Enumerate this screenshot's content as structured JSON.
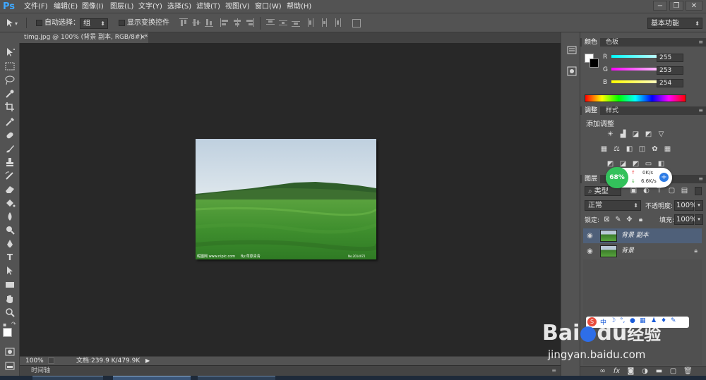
{
  "app": {
    "logo": "Ps"
  },
  "menu": [
    "文件(F)",
    "编辑(E)",
    "图像(I)",
    "图层(L)",
    "文字(Y)",
    "选择(S)",
    "滤镜(T)",
    "视图(V)",
    "窗口(W)",
    "帮助(H)"
  ],
  "window_controls": {
    "minimize": "−",
    "restore": "❐",
    "close": "✕"
  },
  "options": {
    "auto_select_label": "自动选择：",
    "auto_select_value": "组",
    "show_transform_label": "显示变换控件",
    "workspace": "基本功能"
  },
  "document": {
    "tab_title": "timg.jpg @ 100% (背景 副本, RGB/8#) *",
    "tab_close": "×",
    "watermark_left": "昵图网 www.nipic.com",
    "watermark_mid": "By:草原青青",
    "watermark_right": "No.2014072"
  },
  "status": {
    "zoom": "100%",
    "doc_size": "文档:239.9 K/479.9K",
    "timeline": "时间轴"
  },
  "color_panel": {
    "tabs": [
      "颜色",
      "色板"
    ],
    "channels": [
      {
        "label": "R",
        "value": "255",
        "color": "#ff2020"
      },
      {
        "label": "G",
        "value": "253",
        "color": "#20ff20"
      },
      {
        "label": "B",
        "value": "254",
        "color": "#2020ff"
      }
    ]
  },
  "adjustments_panel": {
    "tabs": [
      "调整",
      "样式"
    ],
    "title": "添加调整"
  },
  "layers_panel": {
    "tabs": [
      "图层"
    ],
    "filter_label": "类型",
    "blend_mode": "正常",
    "opacity_label": "不透明度:",
    "opacity": "100%",
    "lock_label": "锁定:",
    "fill_label": "填充:",
    "fill": "100%",
    "layers": [
      {
        "name": "背景 副本",
        "selected": true,
        "locked": false
      },
      {
        "name": "背景",
        "selected": false,
        "locked": true
      }
    ]
  },
  "speed_widget": {
    "percent": "68%",
    "upload": "0K/s",
    "download": "6.6K/s"
  },
  "watermark": {
    "brand": "Bai",
    "brand2": "du",
    "brand_cn": "经验",
    "url": "jingyan.baidu.com"
  },
  "colors": {
    "accent_blue": "#3fa8ff",
    "panel_bg": "#535353",
    "canvas_bg": "#282828",
    "selected_layer": "#4f6079",
    "widget_green": "#33c15b"
  }
}
